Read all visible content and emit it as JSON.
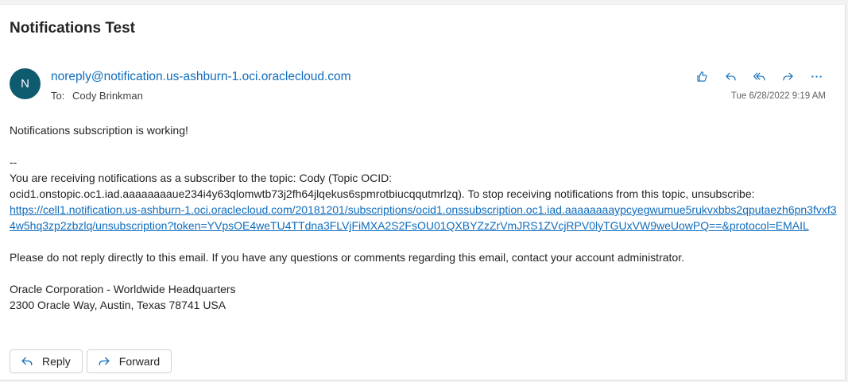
{
  "subject": "Notifications Test",
  "sender": {
    "avatar_initial": "N",
    "email": "noreply@notification.us-ashburn-1.oci.oraclecloud.com",
    "to_label": "To:",
    "to_name": "Cody Brinkman",
    "date": "Tue 6/28/2022 9:19 AM"
  },
  "actions": [
    "like-icon",
    "reply-icon",
    "reply-all-icon",
    "forward-icon",
    "more-icon"
  ],
  "body": {
    "line1": "Notifications subscription is working!",
    "separator": "--",
    "line2": "You are receiving notifications as a subscriber to the topic: Cody (Topic OCID: ocid1.onstopic.oc1.iad.aaaaaaaaue234i4y63qlomwtb73j2fh64jlqekus6spmrotbiucqqutmrlzq). To stop receiving notifications from this topic, unsubscribe:",
    "unsubscribe_link": "https://cell1.notification.us-ashburn-1.oci.oraclecloud.com/20181201/subscriptions/ocid1.onssubscription.oc1.iad.aaaaaaaaypcyegwumue5rukvxbbs2qputaezh6pn3fvxf34w5hq3zp2zbzlq/unsubscription?token=YVpsOE4weTU4TTdna3FLVjFiMXA2S2FsOU01QXBYZzZrVmJRS1ZVcjRPV0lyTGUxVW9weUowPQ==&protocol=EMAIL",
    "line3": "Please do not reply directly to this email. If you have any questions or comments regarding this email, contact your account administrator.",
    "address1": "Oracle Corporation - Worldwide Headquarters",
    "address2": "2300 Oracle Way, Austin, Texas 78741 USA"
  },
  "buttons": {
    "reply": "Reply",
    "forward": "Forward"
  }
}
